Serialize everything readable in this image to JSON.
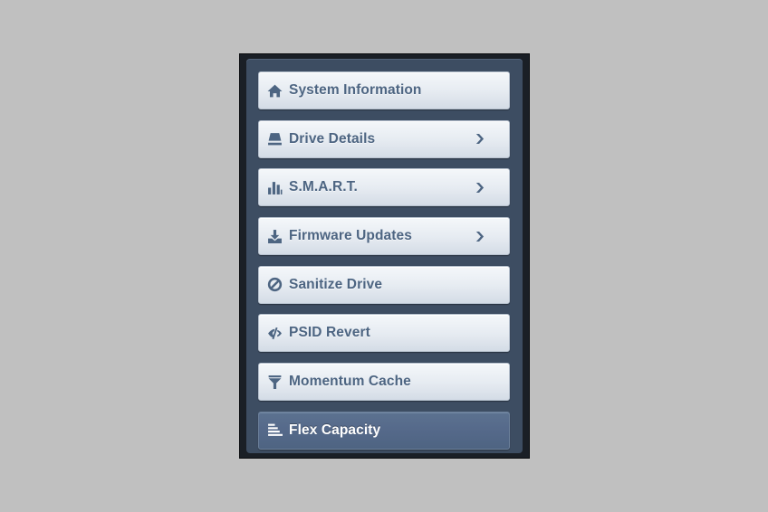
{
  "nav": {
    "items": [
      {
        "label": "System Information",
        "icon": "home-icon",
        "has_submenu": false,
        "active": false
      },
      {
        "label": "Drive Details",
        "icon": "drive-icon",
        "has_submenu": true,
        "active": false
      },
      {
        "label": "S.M.A.R.T.",
        "icon": "bar-chart-icon",
        "has_submenu": true,
        "active": false
      },
      {
        "label": "Firmware Updates",
        "icon": "download-icon",
        "has_submenu": true,
        "active": false
      },
      {
        "label": "Sanitize Drive",
        "icon": "ban-icon",
        "has_submenu": false,
        "active": false
      },
      {
        "label": "PSID Revert",
        "icon": "eye-slash-icon",
        "has_submenu": false,
        "active": false
      },
      {
        "label": "Momentum Cache",
        "icon": "filter-icon",
        "has_submenu": false,
        "active": false
      },
      {
        "label": "Flex Capacity",
        "icon": "align-left-icon",
        "has_submenu": false,
        "active": true
      }
    ]
  },
  "colors": {
    "accent": "#4d6582",
    "active_bg": "#55698a",
    "panel_bg": "#3d4d62",
    "page_bg": "#c0c0c0"
  }
}
